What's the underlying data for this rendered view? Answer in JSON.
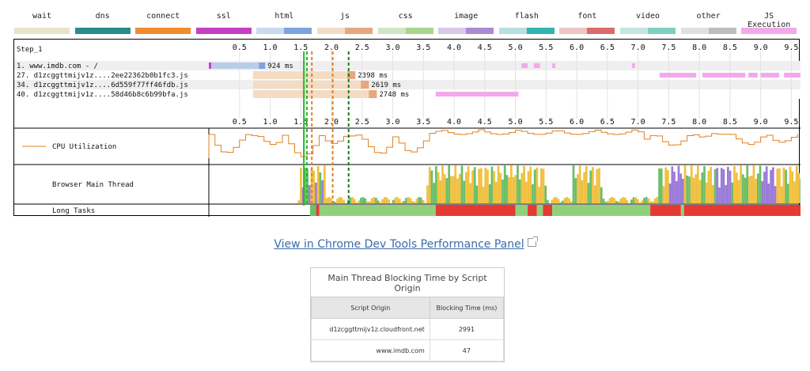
{
  "legend": [
    {
      "label": "wait",
      "c1": "#e8e4c8",
      "c2": "#e8e4c8"
    },
    {
      "label": "dns",
      "c1": "#2b8c8a",
      "c2": "#2b8c8a"
    },
    {
      "label": "connect",
      "c1": "#f08c2c",
      "c2": "#f08c2c"
    },
    {
      "label": "ssl",
      "c1": "#c63fc6",
      "c2": "#c63fc6"
    },
    {
      "label": "html",
      "c1": "#c9d9ef",
      "c2": "#7fa3dd"
    },
    {
      "label": "js",
      "c1": "#f2dcc4",
      "c2": "#e5a87d"
    },
    {
      "label": "css",
      "c1": "#cfe6c4",
      "c2": "#a9d68f"
    },
    {
      "label": "image",
      "c1": "#d8c8ea",
      "c2": "#a98bd3"
    },
    {
      "label": "flash",
      "c1": "#b7e0e0",
      "c2": "#33b2b0"
    },
    {
      "label": "font",
      "c1": "#f0c4c4",
      "c2": "#d96c6c"
    },
    {
      "label": "video",
      "c1": "#c4e6e0",
      "c2": "#7fcfc0"
    },
    {
      "label": "other",
      "c1": "#e0e0e0",
      "c2": "#bdbdbd"
    },
    {
      "label": "JS Execution",
      "c1": "#f4a8ec",
      "c2": "#f4a8ec"
    }
  ],
  "waterfall": {
    "step_label": "Step_1",
    "cpu_label": "CPU Utilization",
    "main_thread_label": "Browser Main Thread",
    "long_tasks_label": "Long Tasks",
    "ticks": [
      "0.5",
      "1.0",
      "1.5",
      "2.0",
      "2.5",
      "3.0",
      "3.5",
      "4.0",
      "4.5",
      "5.0",
      "5.5",
      "6.0",
      "6.5",
      "7.0",
      "7.5",
      "8.0",
      "8.5",
      "9.0",
      "9.5"
    ],
    "max_seconds": 9.65,
    "requests": [
      {
        "label": "1. www.imdb.com - /",
        "start": 0.0,
        "end": 0.92,
        "duration_label": "924 ms",
        "type": "html"
      },
      {
        "label": "27. d1zcggttmijv1z....2ee22362b0b1fc3.js",
        "start": 0.72,
        "end": 2.39,
        "duration_label": "2398 ms",
        "type": "js"
      },
      {
        "label": "34. d1zcggttmijv1z....6d559f77ff46fdb.js",
        "start": 0.72,
        "end": 2.61,
        "duration_label": "2619 ms",
        "type": "js"
      },
      {
        "label": "40. d1zcggttmijv1z....58d46b8c6b99bfa.js",
        "start": 0.72,
        "end": 2.74,
        "duration_label": "2748 ms",
        "type": "js"
      }
    ],
    "js_exec_row1": [
      [
        5.1,
        5.2
      ],
      [
        5.3,
        5.4
      ],
      [
        5.6,
        5.65
      ],
      [
        6.9,
        6.95
      ]
    ],
    "js_exec_row2": [
      [
        7.35,
        7.95
      ],
      [
        8.05,
        8.75
      ],
      [
        8.8,
        8.95
      ],
      [
        9.0,
        9.3
      ],
      [
        9.38,
        9.65
      ]
    ],
    "js_exec_row4": [
      [
        3.7,
        5.05
      ]
    ],
    "markers": [
      {
        "t": 1.55,
        "color": "#28b628",
        "dash": false
      },
      {
        "t": 1.6,
        "color": "#28b628",
        "dash": true
      },
      {
        "t": 1.68,
        "color": "#e08020",
        "dash": true
      },
      {
        "t": 2.02,
        "color": "#e08020",
        "dash": true
      },
      {
        "t": 2.28,
        "color": "#1a7a1a",
        "dash": true
      }
    ]
  },
  "devtools_link": "View in Chrome Dev Tools Performance Panel",
  "blocking_table": {
    "caption": "Main Thread Blocking Time by Script Origin",
    "headers": [
      "Script Origin",
      "Blocking Time (ms)"
    ],
    "rows": [
      {
        "origin": "d1zcggttmijv1z.cloudfront.net",
        "time": "2991"
      },
      {
        "origin": "www.imdb.com",
        "time": "47"
      }
    ]
  }
}
